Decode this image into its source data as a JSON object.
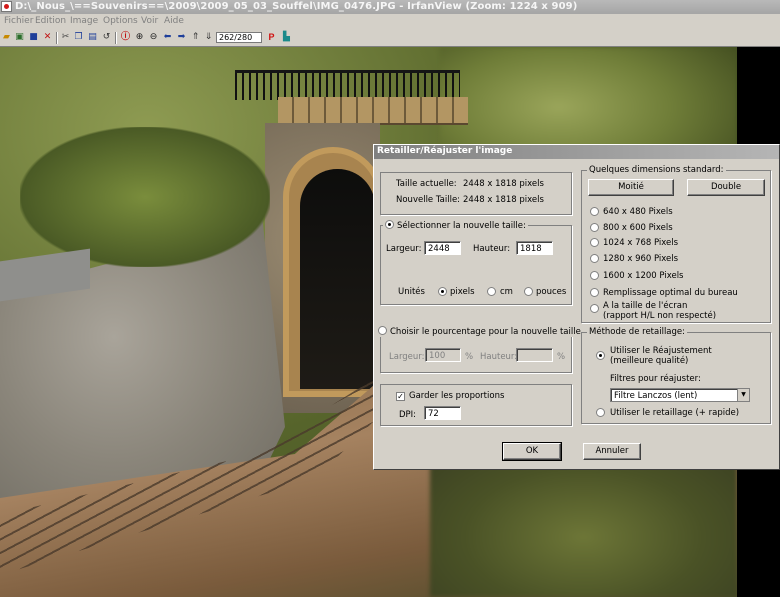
{
  "window": {
    "title": "D:\\_Nous_\\==Souvenirs==\\2009\\2009_05_03_Souffel\\IMG_0476.JPG - IrfanView (Zoom: 1224 x 909)"
  },
  "menu": [
    "Fichier",
    "Edition",
    "Image",
    "Options",
    "Voir",
    "Aide"
  ],
  "toolbar": {
    "icons": [
      "open-icon",
      "slideshow-icon",
      "save-icon",
      "delete-icon",
      "cut-icon",
      "copy-icon",
      "paste-icon",
      "undo-icon",
      "info-icon",
      "zoom-in-icon",
      "zoom-out-icon",
      "previous-icon",
      "next-icon",
      "first-icon",
      "last-icon",
      "paint-icon",
      "settings-icon"
    ],
    "page_counter": "262/280"
  },
  "dialog": {
    "title": "Retailler/Réajuster l'image",
    "current_size_label": "Taille actuelle:",
    "current_size_value": "2448 x 1818 pixels",
    "new_size_label": "Nouvelle Taille:",
    "new_size_value": "2448 x 1818 pixels",
    "select_new_size": "Sélectionner la nouvelle taille:",
    "width_label": "Largeur:",
    "width_value": "2448",
    "height_label": "Hauteur:",
    "height_value": "1818",
    "units_label": "Unités",
    "unit_pixels": "pixels",
    "unit_cm": "cm",
    "unit_inches": "pouces",
    "percent_option": "Choisir le pourcentage pour la nouvelle taille",
    "percent_width_label": "Largeur:",
    "percent_width_value": "100",
    "percent_sign": "%",
    "percent_height_label": "Hauteur:",
    "percent_height_value": "",
    "keep_proportions": "Garder les proportions",
    "dpi_label": "DPI:",
    "dpi_value": "72",
    "standard_group": "Quelques dimensions standard:",
    "half_button": "Moitié",
    "double_button": "Double",
    "standard_sizes": [
      "640 x 480 Pixels",
      "800 x 600 Pixels",
      "1024 x 768 Pixels",
      "1280 x 960 Pixels",
      "1600 x 1200 Pixels"
    ],
    "desktop_fit": "Remplissage optimal du bureau",
    "screen_fit_line1": "A la taille de l'écran",
    "screen_fit_line2": "(rapport H/L non respecté)",
    "method_group": "Méthode de retaillage:",
    "resample_line1": "Utiliser le  Réajustement",
    "resample_line2": "(meilleure qualité)",
    "filter_label": "Filtres pour réajuster:",
    "filter_value": "Filtre Lanczos (lent)",
    "resize_option": "Utiliser le retaillage (+ rapide)",
    "ok_button": "OK",
    "cancel_button": "Annuler"
  }
}
